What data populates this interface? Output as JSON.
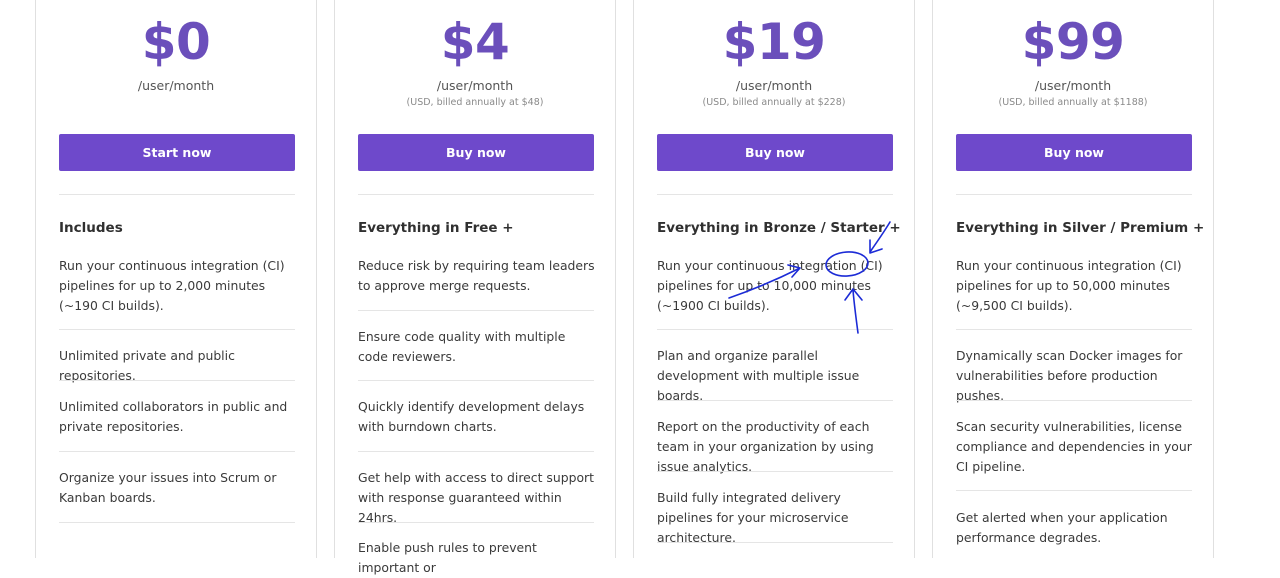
{
  "plans": [
    {
      "price": "$0",
      "period": "/user/month",
      "billed": "",
      "cta": "Start now",
      "heading": "Includes",
      "features": [
        "Run your continuous integration (CI) pipelines for up to 2,000 minutes (~190 CI builds).",
        "Unlimited private and public repositories.",
        "Unlimited collaborators in public and private repositories.",
        "Organize your issues into Scrum or Kanban boards."
      ]
    },
    {
      "price": "$4",
      "period": "/user/month",
      "billed": "(USD, billed annually at $48)",
      "cta": "Buy now",
      "heading": "Everything in Free +",
      "features": [
        "Reduce risk by requiring team leaders to approve merge requests.",
        "Ensure code quality with multiple code reviewers.",
        "Quickly identify development delays with burndown charts.",
        "Get help with access to direct support with response guaranteed within 24hrs.",
        "Enable push rules to prevent important or"
      ]
    },
    {
      "price": "$19",
      "period": "/user/month",
      "billed": "(USD, billed annually at $228)",
      "cta": "Buy now",
      "heading": "Everything in Bronze / Starter +",
      "features": [
        "Run your continuous integration (CI) pipelines for up to 10,000 minutes (~1900 CI builds).",
        "Plan and organize parallel development with multiple issue boards.",
        "Report on the productivity of each team in your organization by using issue analytics.",
        "Build fully integrated delivery pipelines for your microservice architecture."
      ]
    },
    {
      "price": "$99",
      "period": "/user/month",
      "billed": "(USD, billed annually at $1188)",
      "cta": "Buy now",
      "heading": "Everything in Silver / Premium +",
      "features": [
        "Run your continuous integration (CI) pipelines for up to 50,000 minutes (~9,500 CI builds).",
        "Dynamically scan Docker images for vulnerabilities before production pushes.",
        "Scan security vulnerabilities, license compliance and dependencies in your CI pipeline.",
        "Get alerted when your application performance degrades."
      ]
    }
  ],
  "colors": {
    "accent": "#6e49cb",
    "price": "#6b4fbb",
    "annotation": "#1c2bd6"
  }
}
